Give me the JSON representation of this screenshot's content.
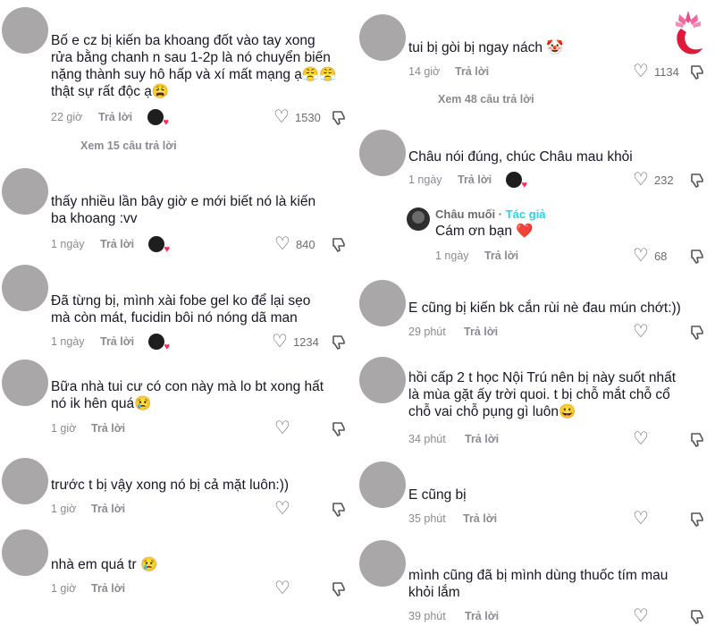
{
  "left_comments": [
    {
      "text": "Bố e cz bị kiến ba khoang đốt vào tay xong\nrửa bằng chanh n sau 1-2p là nó chuyển biến\nnặng thành suy hô hấp và xí mất mạng ạ😤😤\nthật sự rất độc ạ😩",
      "time": "22 giờ",
      "reply": "Trả lời",
      "likes": "1530",
      "creator_liked": true,
      "view_more": "Xem 15 câu trả lời"
    },
    {
      "text": "thấy nhiều lần bây giờ e mới biết nó là kiến\nba khoang :vv",
      "time": "1 ngày",
      "reply": "Trả lời",
      "likes": "840",
      "creator_liked": true
    },
    {
      "text": "Đã từng bị, mình xài fobe gel ko để lại sẹo\nmà còn mát, fucidin bôi nó nóng dã man",
      "time": "1 ngày",
      "reply": "Trả lời",
      "likes": "1234",
      "creator_liked": true
    },
    {
      "text": "Bữa nhà tui cư có con này mà lo bt xong hất\nnó ik hên quá😢",
      "time": "1 giờ",
      "reply": "Trả lời",
      "likes": ""
    },
    {
      "text": "trước t bị vậy xong nó bị cả mặt luôn:))",
      "time": "1 giờ",
      "reply": "Trả lời",
      "likes": ""
    },
    {
      "text": "nhà em quá tr 😢",
      "time": "1 giờ",
      "reply": "Trả lời",
      "likes": ""
    }
  ],
  "right_comments": [
    {
      "text": "tui bị gòi bị ngay nách 🤡",
      "time": "14 giờ",
      "reply": "Trả lời",
      "likes": "1134",
      "view_more": "Xem 48 câu trả lời"
    },
    {
      "text": "Châu nói đúng, chúc Châu mau khỏi",
      "time": "1 ngày",
      "reply": "Trả lời",
      "likes": "232",
      "creator_liked": true
    },
    {
      "text": "E cũng bị kiến bk cắn rùi nè đau mún chớt:))",
      "time": "29 phút",
      "reply": "Trả lời",
      "likes": ""
    },
    {
      "text": "hồi cấp 2 t học Nội Trú nên bị này suốt nhất\nlà mùa gặt ấy trời quoi. t bị chỗ mắt chỗ cổ\nchỗ vai chỗ pụng gì luôn😀",
      "time": "34 phút",
      "reply": "Trả lời",
      "likes": ""
    },
    {
      "text": "E cũng bị",
      "time": "35 phút",
      "reply": "Trả lời",
      "likes": ""
    },
    {
      "text": "mình cũng đã bị mình dùng thuốc tím mau\nkhỏi lắm",
      "time": "39 phút",
      "reply": "Trả lời",
      "likes": ""
    }
  ],
  "author_reply": {
    "name": "Châu muối",
    "separator": " · ",
    "tag": "Tác giả",
    "text": "Cám ơn bạn ❤️",
    "time": "1 ngày",
    "reply": "Trả lời",
    "likes": "68"
  },
  "icons": {
    "heart": "heart-outline-icon",
    "dislike": "thumbs-down-icon",
    "logo": "lotus-face-logo"
  },
  "colors": {
    "accent": "#fe2c55",
    "author_tag": "#20d5ec",
    "avatar_placeholder": "#a9a7a8",
    "meta": "#8a8b91"
  }
}
